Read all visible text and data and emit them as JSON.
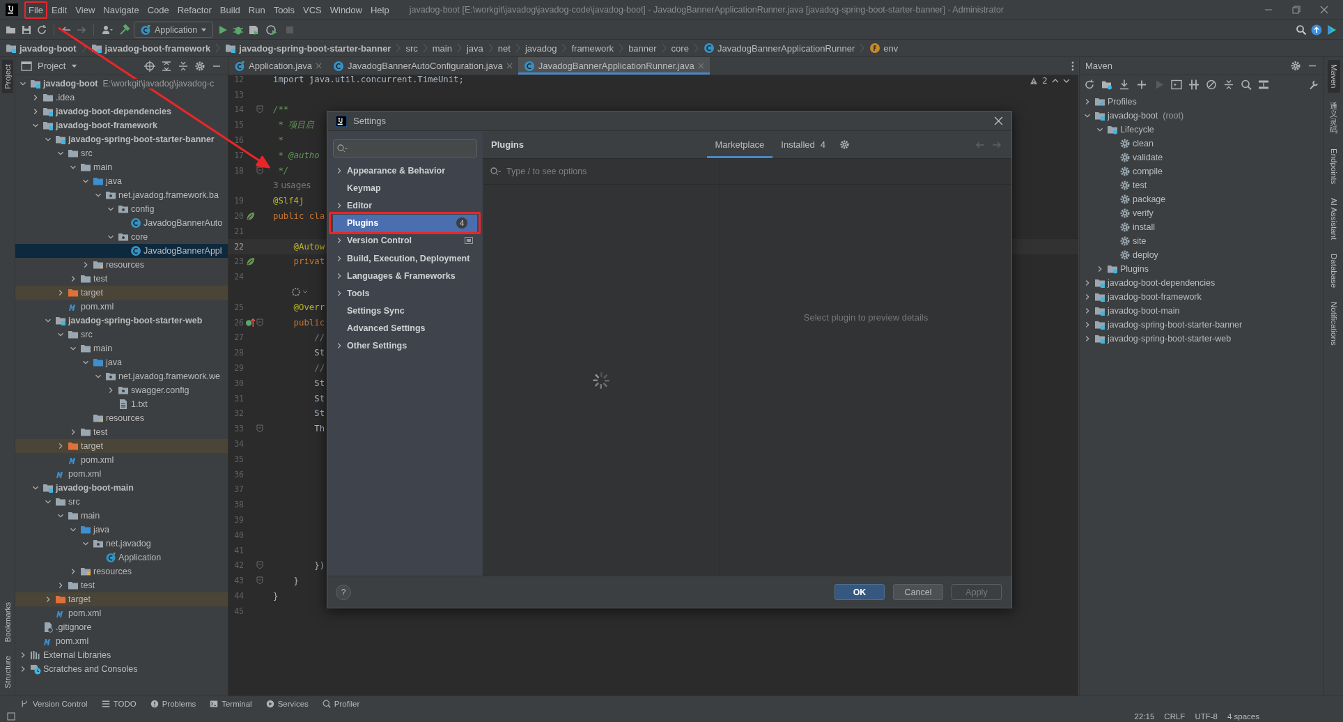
{
  "window": {
    "title": "javadog-boot [E:\\workgit\\javadog\\javadog-code\\javadog-boot] - JavadogBannerApplicationRunner.java [javadog-spring-boot-starter-banner] - Administrator"
  },
  "menu": [
    {
      "label": "File",
      "annotated": true
    },
    {
      "label": "Edit",
      "annotated": false
    },
    {
      "label": "View",
      "annotated": false
    },
    {
      "label": "Navigate",
      "annotated": false
    },
    {
      "label": "Code",
      "annotated": false
    },
    {
      "label": "Refactor",
      "annotated": false
    },
    {
      "label": "Build",
      "annotated": false
    },
    {
      "label": "Run",
      "annotated": false
    },
    {
      "label": "Tools",
      "annotated": false
    },
    {
      "label": "VCS",
      "annotated": false
    },
    {
      "label": "Window",
      "annotated": false
    },
    {
      "label": "Help",
      "annotated": false
    }
  ],
  "toolbar": {
    "run_config": "Application"
  },
  "breadcrumb": [
    {
      "label": "javadog-boot",
      "kind": "module"
    },
    {
      "label": "javadog-boot-framework",
      "kind": "module"
    },
    {
      "label": "javadog-spring-boot-starter-banner",
      "kind": "module"
    },
    {
      "label": "src",
      "kind": "dir"
    },
    {
      "label": "main",
      "kind": "dir"
    },
    {
      "label": "java",
      "kind": "dir"
    },
    {
      "label": "net",
      "kind": "dir"
    },
    {
      "label": "javadog",
      "kind": "dir"
    },
    {
      "label": "framework",
      "kind": "dir"
    },
    {
      "label": "banner",
      "kind": "dir"
    },
    {
      "label": "core",
      "kind": "dir"
    },
    {
      "label": "JavadogBannerApplicationRunner",
      "kind": "class"
    },
    {
      "label": "env",
      "kind": "field"
    }
  ],
  "left_stripe": {
    "top": [
      {
        "label": "Project",
        "selected": true
      }
    ],
    "bottom": [
      {
        "label": "Bookmarks",
        "selected": false
      },
      {
        "label": "Structure",
        "selected": false
      }
    ]
  },
  "project": {
    "title": "Project",
    "tree": [
      {
        "label": "javadog-boot",
        "hint": "E:\\workgit\\javadog\\javadog-c",
        "kind": "module",
        "expanded": true,
        "selected": false,
        "children": [
          {
            "label": ".idea",
            "kind": "folder",
            "expanded": false,
            "selected": false
          },
          {
            "label": "javadog-boot-dependencies",
            "kind": "module",
            "expanded": false,
            "selected": false
          },
          {
            "label": "javadog-boot-framework",
            "kind": "module",
            "expanded": true,
            "selected": false,
            "children": [
              {
                "label": "javadog-spring-boot-starter-banner",
                "kind": "module",
                "expanded": true,
                "selected": false,
                "children": [
                  {
                    "label": "src",
                    "kind": "folder",
                    "expanded": true,
                    "selected": false,
                    "children": [
                      {
                        "label": "main",
                        "kind": "folder",
                        "expanded": true,
                        "selected": false,
                        "children": [
                          {
                            "label": "java",
                            "kind": "source",
                            "expanded": true,
                            "selected": false,
                            "children": [
                              {
                                "label": "net.javadog.framework.ba",
                                "kind": "package",
                                "expanded": true,
                                "selected": false,
                                "children": [
                                  {
                                    "label": "config",
                                    "kind": "package",
                                    "expanded": true,
                                    "selected": false,
                                    "children": [
                                      {
                                        "label": "JavadogBannerAuto",
                                        "kind": "class",
                                        "selected": false
                                      }
                                    ]
                                  },
                                  {
                                    "label": "core",
                                    "kind": "package",
                                    "expanded": true,
                                    "selected": false,
                                    "children": [
                                      {
                                        "label": "JavadogBannerAppl",
                                        "kind": "class",
                                        "selected": true
                                      }
                                    ]
                                  }
                                ]
                              }
                            ]
                          },
                          {
                            "label": "resources",
                            "kind": "resources",
                            "expanded": false,
                            "selected": false
                          }
                        ]
                      },
                      {
                        "label": "test",
                        "kind": "folder",
                        "expanded": false,
                        "selected": false
                      }
                    ]
                  },
                  {
                    "label": "target",
                    "kind": "excluded",
                    "expanded": false,
                    "selected": false
                  },
                  {
                    "label": "pom.xml",
                    "kind": "maven",
                    "selected": false
                  }
                ]
              },
              {
                "label": "javadog-spring-boot-starter-web",
                "kind": "module",
                "expanded": true,
                "selected": false,
                "children": [
                  {
                    "label": "src",
                    "kind": "folder",
                    "expanded": true,
                    "selected": false,
                    "children": [
                      {
                        "label": "main",
                        "kind": "folder",
                        "expanded": true,
                        "selected": false,
                        "children": [
                          {
                            "label": "java",
                            "kind": "source",
                            "expanded": true,
                            "selected": false,
                            "children": [
                              {
                                "label": "net.javadog.framework.we",
                                "kind": "package",
                                "expanded": true,
                                "selected": false,
                                "children": [
                                  {
                                    "label": "swagger.config",
                                    "kind": "package",
                                    "expanded": false,
                                    "selected": false
                                  },
                                  {
                                    "label": "1.txt",
                                    "kind": "file",
                                    "selected": false
                                  }
                                ]
                              }
                            ]
                          },
                          {
                            "label": "resources",
                            "kind": "resources",
                            "selected": false
                          }
                        ]
                      },
                      {
                        "label": "test",
                        "kind": "folder",
                        "expanded": false,
                        "selected": false
                      }
                    ]
                  },
                  {
                    "label": "target",
                    "kind": "excluded",
                    "expanded": false,
                    "selected": false
                  },
                  {
                    "label": "pom.xml",
                    "kind": "maven",
                    "selected": false
                  }
                ]
              },
              {
                "label": "pom.xml",
                "kind": "maven",
                "selected": false
              }
            ]
          },
          {
            "label": "javadog-boot-main",
            "kind": "module",
            "expanded": true,
            "selected": false,
            "children": [
              {
                "label": "src",
                "kind": "folder",
                "expanded": true,
                "selected": false,
                "children": [
                  {
                    "label": "main",
                    "kind": "folder",
                    "expanded": true,
                    "selected": false,
                    "children": [
                      {
                        "label": "java",
                        "kind": "source",
                        "expanded": true,
                        "selected": false,
                        "children": [
                          {
                            "label": "net.javadog",
                            "kind": "package",
                            "expanded": true,
                            "selected": false,
                            "children": [
                              {
                                "label": "Application",
                                "kind": "app",
                                "selected": false
                              }
                            ]
                          }
                        ]
                      },
                      {
                        "label": "resources",
                        "kind": "resources",
                        "expanded": false,
                        "selected": false
                      }
                    ]
                  },
                  {
                    "label": "test",
                    "kind": "folder",
                    "expanded": false,
                    "selected": false
                  }
                ]
              },
              {
                "label": "target",
                "kind": "excluded",
                "expanded": false,
                "selected": false
              },
              {
                "label": "pom.xml",
                "kind": "maven",
                "selected": false
              }
            ]
          },
          {
            "label": ".gitignore",
            "kind": "gitignore",
            "selected": false
          },
          {
            "label": "pom.xml",
            "kind": "maven",
            "selected": false
          }
        ]
      },
      {
        "label": "External Libraries",
        "kind": "libraries",
        "expanded": false,
        "selected": false
      },
      {
        "label": "Scratches and Consoles",
        "kind": "scratches",
        "expanded": false,
        "selected": false
      }
    ]
  },
  "editor": {
    "tabs": [
      {
        "label": "Application.java",
        "kind": "app",
        "selected": false
      },
      {
        "label": "JavadogBannerAutoConfiguration.java",
        "kind": "class",
        "selected": false
      },
      {
        "label": "JavadogBannerApplicationRunner.java",
        "kind": "class",
        "selected": true
      }
    ],
    "warnings": "2",
    "lines": [
      {
        "n": "12",
        "text": "import java.util.concurrent.TimeUnit;",
        "kind": "code",
        "current": false
      },
      {
        "n": "13",
        "kind": "code",
        "current": false
      },
      {
        "n": "14",
        "text": "/**",
        "kind": "comment",
        "current": false,
        "fold": true
      },
      {
        "n": "15",
        "text": " * 项目启",
        "kind": "comment",
        "current": false
      },
      {
        "n": "16",
        "text": " *",
        "kind": "comment",
        "current": false
      },
      {
        "n": "17",
        "text": " * @autho",
        "kind": "comment",
        "current": false
      },
      {
        "n": "18",
        "text": " */",
        "kind": "comment",
        "current": false,
        "fold": true
      },
      {
        "text": "3 usages",
        "kind": "hint"
      },
      {
        "n": "19",
        "text": "@Slf4j",
        "kind": "annotation",
        "current": false
      },
      {
        "n": "20",
        "text": "public cla",
        "kind": "keyword",
        "current": false,
        "gutter": {
          "kind": "bean"
        }
      },
      {
        "n": "21",
        "kind": "code",
        "current": false
      },
      {
        "n": "22",
        "text": "    @Autow",
        "kind": "annotation",
        "current": true
      },
      {
        "n": "23",
        "text": "    privat",
        "kind": "keyword",
        "current": false,
        "gutter": {
          "kind": "bean"
        }
      },
      {
        "n": "24",
        "kind": "code",
        "current": false
      },
      {
        "kind": "inlay"
      },
      {
        "n": "25",
        "text": "    @Overr",
        "kind": "annotation",
        "current": false
      },
      {
        "n": "26",
        "text": "    public",
        "kind": "keyword",
        "current": false,
        "gutter": {
          "kind": "override"
        },
        "fold": true
      },
      {
        "n": "27",
        "text": "        //",
        "kind": "linecomment",
        "current": false
      },
      {
        "n": "28",
        "text": "        St",
        "kind": "code",
        "current": false
      },
      {
        "n": "29",
        "text": "        //",
        "kind": "linecomment",
        "current": false
      },
      {
        "n": "30",
        "text": "        St",
        "kind": "code",
        "current": false
      },
      {
        "n": "31",
        "text": "        St",
        "kind": "code",
        "current": false
      },
      {
        "n": "32",
        "text": "        St",
        "kind": "code",
        "current": false
      },
      {
        "n": "33",
        "text": "        Th",
        "kind": "code",
        "current": false,
        "fold": true
      },
      {
        "n": "34",
        "kind": "code",
        "current": false
      },
      {
        "n": "35",
        "kind": "code",
        "current": false
      },
      {
        "n": "36",
        "kind": "code",
        "current": false
      },
      {
        "n": "37",
        "kind": "code",
        "current": false
      },
      {
        "n": "38",
        "kind": "code",
        "current": false
      },
      {
        "n": "39",
        "kind": "code",
        "current": false
      },
      {
        "n": "40",
        "kind": "code",
        "current": false
      },
      {
        "n": "41",
        "kind": "code",
        "current": false
      },
      {
        "n": "42",
        "text": "        })",
        "kind": "code",
        "current": false,
        "fold": true
      },
      {
        "n": "43",
        "text": "    }",
        "kind": "code",
        "current": false,
        "fold": true
      },
      {
        "n": "44",
        "text": "}",
        "kind": "code",
        "current": false
      },
      {
        "n": "45",
        "kind": "code",
        "current": false
      }
    ]
  },
  "maven": {
    "title": "Maven",
    "tree": [
      {
        "label": "Profiles",
        "kind": "profiles",
        "expanded": false
      },
      {
        "label": "javadog-boot",
        "hint": "(root)",
        "kind": "module",
        "expanded": true,
        "children": [
          {
            "label": "Lifecycle",
            "kind": "lifecycle",
            "expanded": true,
            "children": [
              {
                "label": "clean",
                "kind": "goal"
              },
              {
                "label": "validate",
                "kind": "goal"
              },
              {
                "label": "compile",
                "kind": "goal"
              },
              {
                "label": "test",
                "kind": "goal"
              },
              {
                "label": "package",
                "kind": "goal"
              },
              {
                "label": "verify",
                "kind": "goal"
              },
              {
                "label": "install",
                "kind": "goal"
              },
              {
                "label": "site",
                "kind": "goal"
              },
              {
                "label": "deploy",
                "kind": "goal"
              }
            ]
          },
          {
            "label": "Plugins",
            "kind": "lifecycle",
            "expanded": false
          }
        ]
      },
      {
        "label": "javadog-boot-dependencies",
        "kind": "module",
        "expanded": false
      },
      {
        "label": "javadog-boot-framework",
        "kind": "module",
        "expanded": false
      },
      {
        "label": "javadog-boot-main",
        "kind": "module",
        "expanded": false
      },
      {
        "label": "javadog-spring-boot-starter-banner",
        "kind": "module",
        "expanded": false
      },
      {
        "label": "javadog-spring-boot-starter-web",
        "kind": "module",
        "expanded": false
      }
    ]
  },
  "right_stripe": [
    {
      "label": "Maven",
      "selected": true
    },
    {
      "label": "通义灵码",
      "selected": false
    },
    {
      "label": "Endpoints",
      "selected": false
    },
    {
      "label": "AI Assistant",
      "selected": false
    },
    {
      "label": "Database",
      "selected": false
    },
    {
      "label": "Notifications",
      "selected": false
    }
  ],
  "bottom_tools": [
    {
      "label": "Version Control",
      "kind": "vcs"
    },
    {
      "label": "TODO",
      "kind": "todo"
    },
    {
      "label": "Problems",
      "kind": "problems"
    },
    {
      "label": "Terminal",
      "kind": "terminal"
    },
    {
      "label": "Services",
      "kind": "services"
    },
    {
      "label": "Profiler",
      "kind": "profiler"
    }
  ],
  "status_bar": [
    "22:15",
    "CRLF",
    "UTF-8",
    "4 spaces"
  ],
  "dialog": {
    "title": "Settings",
    "nav": [
      {
        "label": "Appearance & Behavior",
        "expanded": false,
        "selected": false,
        "annotated": false
      },
      {
        "label": "Keymap",
        "selected": false,
        "annotated": false
      },
      {
        "label": "Editor",
        "expanded": false,
        "selected": false,
        "annotated": false
      },
      {
        "label": "Plugins",
        "badge": "4",
        "selected": true,
        "annotated": true
      },
      {
        "label": "Version Control",
        "expanded": false,
        "selected": false,
        "annotated": false,
        "project_scope": true
      },
      {
        "label": "Build, Execution, Deployment",
        "expanded": false,
        "selected": false,
        "annotated": false
      },
      {
        "label": "Languages & Frameworks",
        "expanded": false,
        "selected": false,
        "annotated": false
      },
      {
        "label": "Tools",
        "expanded": false,
        "selected": false,
        "annotated": false
      },
      {
        "label": "Settings Sync",
        "selected": false,
        "annotated": false
      },
      {
        "label": "Advanced Settings",
        "selected": false,
        "annotated": false
      },
      {
        "label": "Other Settings",
        "expanded": false,
        "selected": false,
        "annotated": false
      }
    ],
    "heading": "Plugins",
    "tabs": [
      {
        "label": "Marketplace",
        "selected": true
      },
      {
        "label": "Installed",
        "count": "4",
        "selected": false
      }
    ],
    "search": {
      "placeholder": "Type / to see options"
    },
    "detail": "Select plugin to preview details",
    "help": "?",
    "buttons": [
      {
        "label": "OK",
        "kind": "primary",
        "disabled": false
      },
      {
        "label": "Cancel",
        "kind": "normal",
        "disabled": false
      },
      {
        "label": "Apply",
        "kind": "normal",
        "disabled": true
      }
    ]
  }
}
